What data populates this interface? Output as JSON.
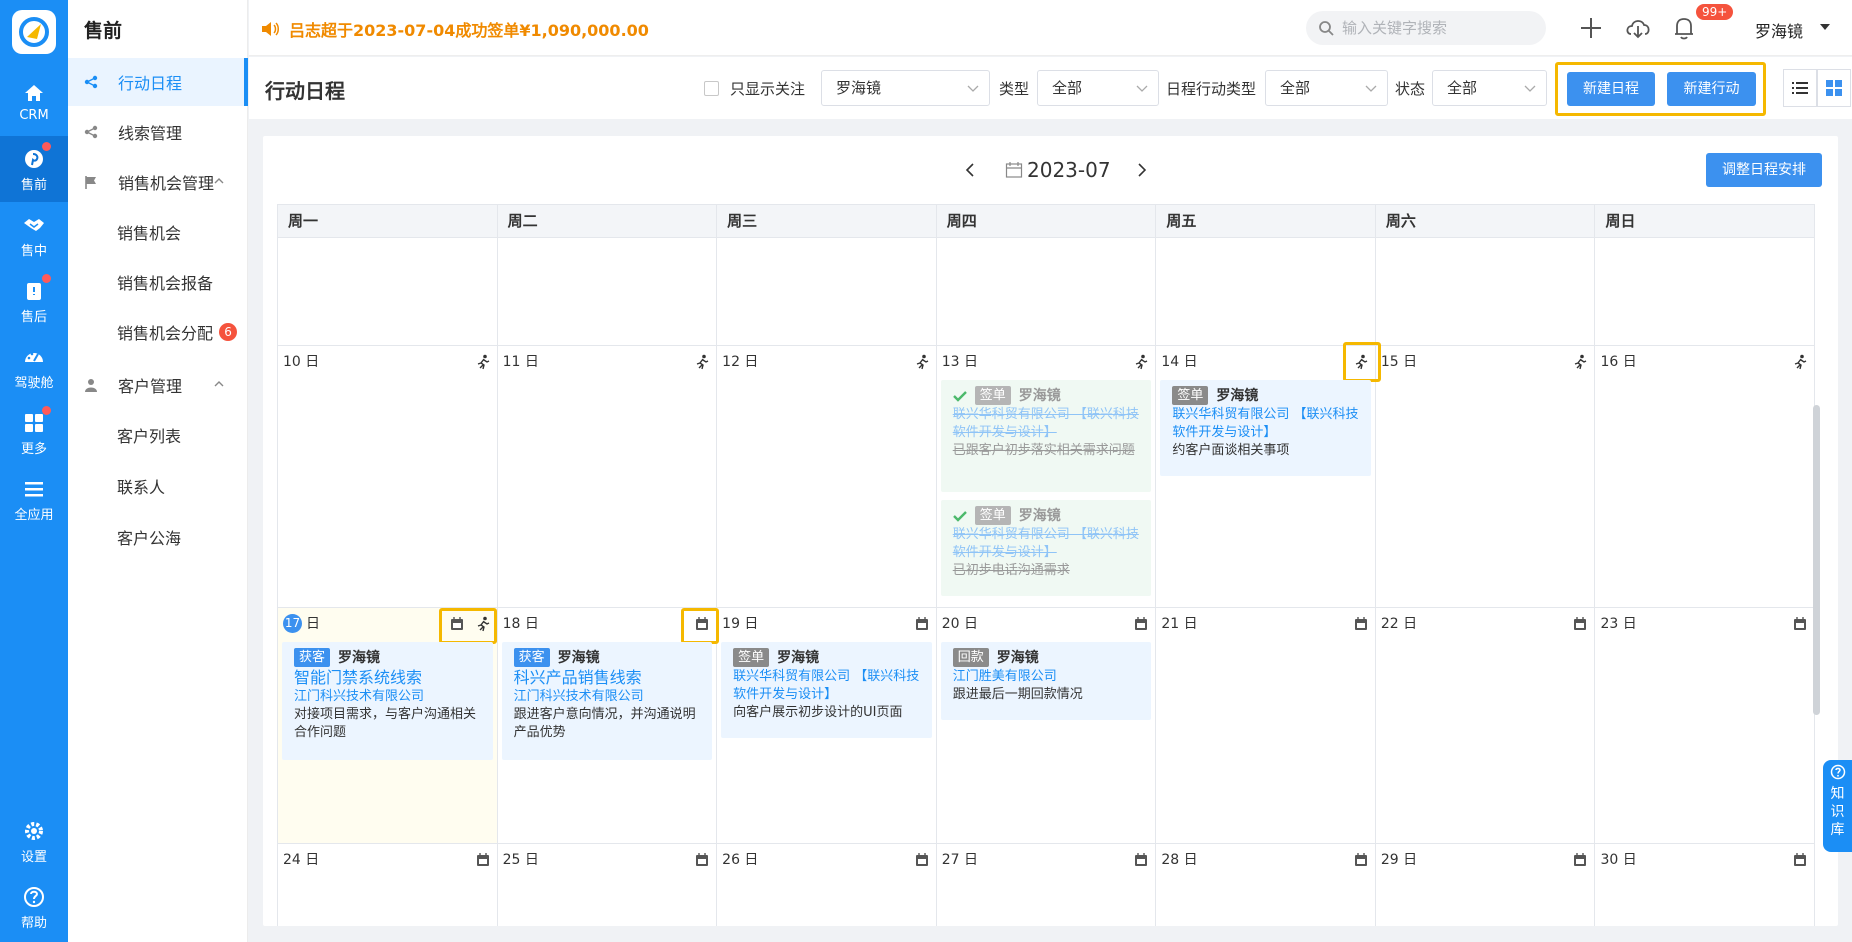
{
  "rail": {
    "items": [
      {
        "label": "CRM"
      },
      {
        "label": "售前"
      },
      {
        "label": "售中"
      },
      {
        "label": "售后"
      },
      {
        "label": "驾驶舱"
      },
      {
        "label": "更多"
      },
      {
        "label": "全应用"
      }
    ],
    "settings": "设置",
    "help": "帮助"
  },
  "nav": {
    "title": "售前",
    "items": [
      {
        "label": "行动日程"
      },
      {
        "label": "线索管理"
      },
      {
        "label": "销售机会管理"
      },
      {
        "label": "销售机会"
      },
      {
        "label": "销售机会报备"
      },
      {
        "label": "销售机会分配",
        "badge": "6"
      },
      {
        "label": "客户管理"
      },
      {
        "label": "客户列表"
      },
      {
        "label": "联系人"
      },
      {
        "label": "客户公海"
      }
    ]
  },
  "topbar": {
    "notice": "吕志超于2023-07-04成功签单¥1,090,000.00",
    "search_placeholder": "输入关键字搜索",
    "bell_badge": "99+",
    "user": "罗海镜"
  },
  "toolbar": {
    "title": "行动日程",
    "only_follow": "只显示关注",
    "owner_value": "罗海镜",
    "type_label": "类型",
    "type_value": "全部",
    "action_type_label": "日程行动类型",
    "action_type_value": "全部",
    "status_label": "状态",
    "status_value": "全部",
    "new_schedule": "新建日程",
    "new_action": "新建行动"
  },
  "calendar": {
    "month": "2023-07",
    "adjust": "调整日程安排",
    "weekdays": [
      "周一",
      "周二",
      "周三",
      "周四",
      "周五",
      "周六",
      "周日"
    ],
    "week2_days": [
      "10 日",
      "11 日",
      "12 日",
      "13 日",
      "14 日",
      "15 日",
      "16 日"
    ],
    "week3_days": [
      "日",
      "18 日",
      "19 日",
      "20 日",
      "21 日",
      "22 日",
      "23 日"
    ],
    "today_num": "17",
    "week4_days": [
      "24 日",
      "25 日",
      "26 日",
      "27 日",
      "28 日",
      "29 日",
      "30 日"
    ],
    "events": {
      "e13a": {
        "tag": "签单",
        "owner": "罗海镜",
        "link": "联兴华科贸有限公司 【联兴科技软件开发与设计】",
        "desc": "已跟客户初步落实相关需求问题"
      },
      "e13b": {
        "tag": "签单",
        "owner": "罗海镜",
        "link": "联兴华科贸有限公司 【联兴科技软件开发与设计】",
        "desc": "已初步电话沟通需求"
      },
      "e14": {
        "tag": "签单",
        "owner": "罗海镜",
        "link": "联兴华科贸有限公司 【联兴科技软件开发与设计】",
        "desc": "约客户面谈相关事项"
      },
      "e17": {
        "tag": "获客",
        "owner": "罗海镜",
        "title": "智能门禁系统线索",
        "link": "江门科兴技术有限公司",
        "desc": "对接项目需求，与客户沟通相关合作问题"
      },
      "e18": {
        "tag": "获客",
        "owner": "罗海镜",
        "title": "科兴产品销售线索",
        "link": "江门科兴技术有限公司",
        "desc": "跟进客户意向情况，并沟通说明产品优势"
      },
      "e19": {
        "tag": "签单",
        "owner": "罗海镜",
        "link": "联兴华科贸有限公司 【联兴科技软件开发与设计】",
        "desc": "向客户展示初步设计的UI页面"
      },
      "e20": {
        "tag": "回款",
        "owner": "罗海镜",
        "link": "江门胜美有限公司",
        "desc": "跟进最后一期回款情况"
      }
    }
  },
  "knowledge": "知识库"
}
